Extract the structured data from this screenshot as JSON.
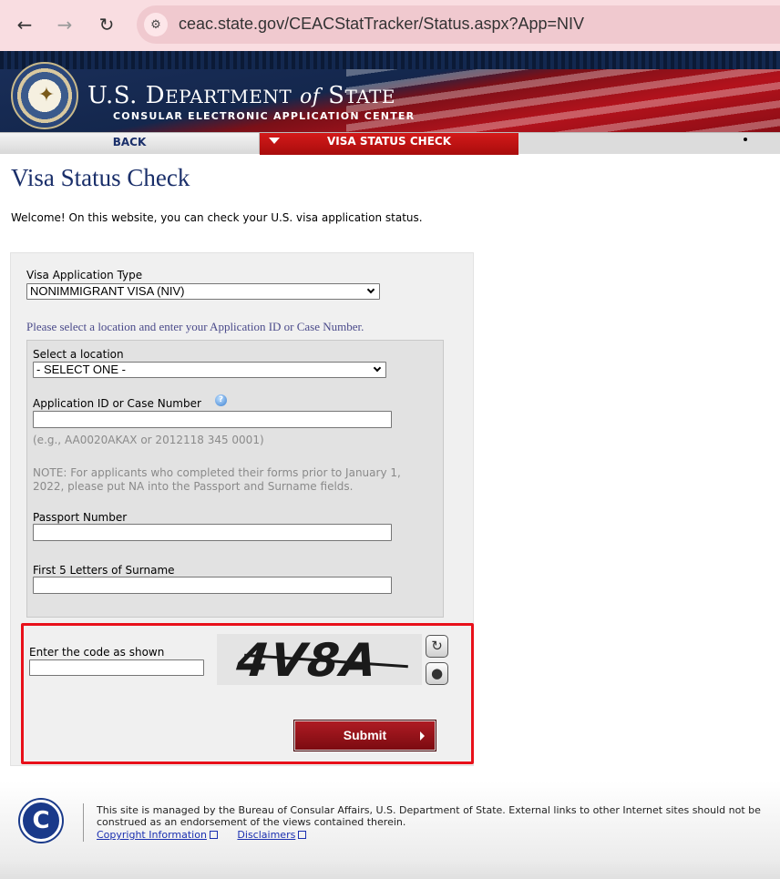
{
  "browser": {
    "url": "ceac.state.gov/CEACStatTracker/Status.aspx?App=NIV"
  },
  "header": {
    "seal_text": "DEPARTMENT OF STATE · UNITED STATES OF AMERICA",
    "title": "U.S. Department of State",
    "subtitle": "CONSULAR ELECTRONIC APPLICATION CENTER"
  },
  "nav": {
    "back_label": "BACK",
    "active_label": "VISA STATUS CHECK"
  },
  "page": {
    "title": "Visa Status Check",
    "welcome": "Welcome! On this website, you can check your U.S. visa application status."
  },
  "form": {
    "app_type_label": "Visa Application Type",
    "app_type_value": "NONIMMIGRANT VISA (NIV)",
    "instructions": "Please select a location and enter your Application ID or Case Number.",
    "location_label": "Select a location",
    "location_value": "- SELECT ONE -",
    "app_id_label": "Application ID or Case Number",
    "app_id_value": "",
    "app_id_hint": "(e.g., AA0020AKAX or 2012118 345 0001)",
    "note": "NOTE: For applicants who completed their forms prior to January 1, 2022, please put NA into the Passport and Surname fields.",
    "passport_label": "Passport Number",
    "passport_value": "",
    "surname_label": "First 5 Letters of Surname",
    "surname_value": "",
    "captcha_label": "Enter the code as shown",
    "captcha_value": "",
    "captcha_code": "4V8A",
    "submit_label": "Submit"
  },
  "footer": {
    "text": "This site is managed by the Bureau of Consular Affairs, U.S. Department of State. External links to other Internet sites should not be construed as an endorsement of the views contained therein.",
    "links": [
      "Copyright Information",
      "Disclaimers"
    ]
  },
  "colors": {
    "brand_navy": "#1a2f6a",
    "brand_red": "#b01c24",
    "highlight_border": "#e8101a"
  }
}
